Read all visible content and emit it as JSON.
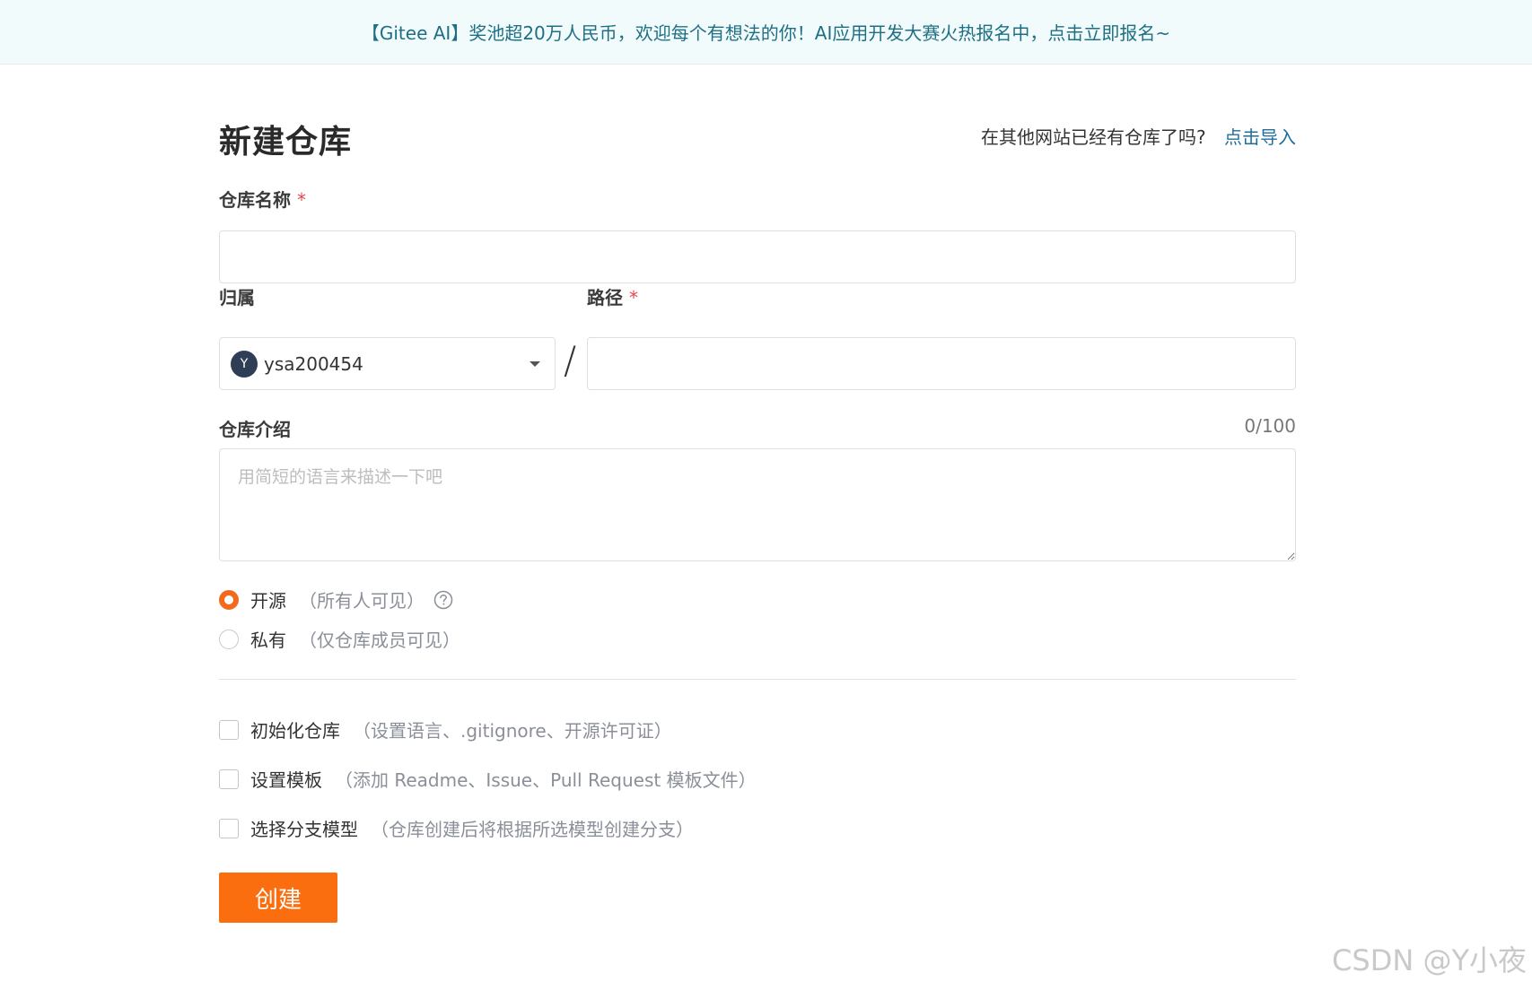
{
  "banner": {
    "text": "【Gitee AI】奖池超20万人民币，欢迎每个有想法的你！AI应用开发大赛火热报名中，点击立即报名~"
  },
  "header": {
    "title": "新建仓库",
    "import_hint": "在其他网站已经有仓库了吗?",
    "import_link": "点击导入"
  },
  "form": {
    "repo_name_label": "仓库名称",
    "required_mark": "*",
    "owner_label": "归属",
    "owner_avatar_letter": "Y",
    "owner_value": "ysa200454",
    "path_separator": "/",
    "path_label": "路径",
    "desc_label": "仓库介绍",
    "desc_counter": "0/100",
    "desc_placeholder": "用简短的语言来描述一下吧"
  },
  "visibility": [
    {
      "label": "开源",
      "hint": "（所有人可见）",
      "checked": true
    },
    {
      "label": "私有",
      "hint": "（仅仓库成员可见）",
      "checked": false
    }
  ],
  "options": [
    {
      "label": "初始化仓库",
      "hint": "（设置语言、.gitignore、开源许可证）"
    },
    {
      "label": "设置模板",
      "hint": "（添加 Readme、Issue、Pull Request 模板文件）"
    },
    {
      "label": "选择分支模型",
      "hint": "（仓库创建后将根据所选模型创建分支）"
    }
  ],
  "create_button": "创建",
  "watermark": "CSDN @Y小夜",
  "colors": {
    "accent": "#fa6e10",
    "link": "#1f6f9e",
    "banner_bg": "#f1fbfb"
  }
}
